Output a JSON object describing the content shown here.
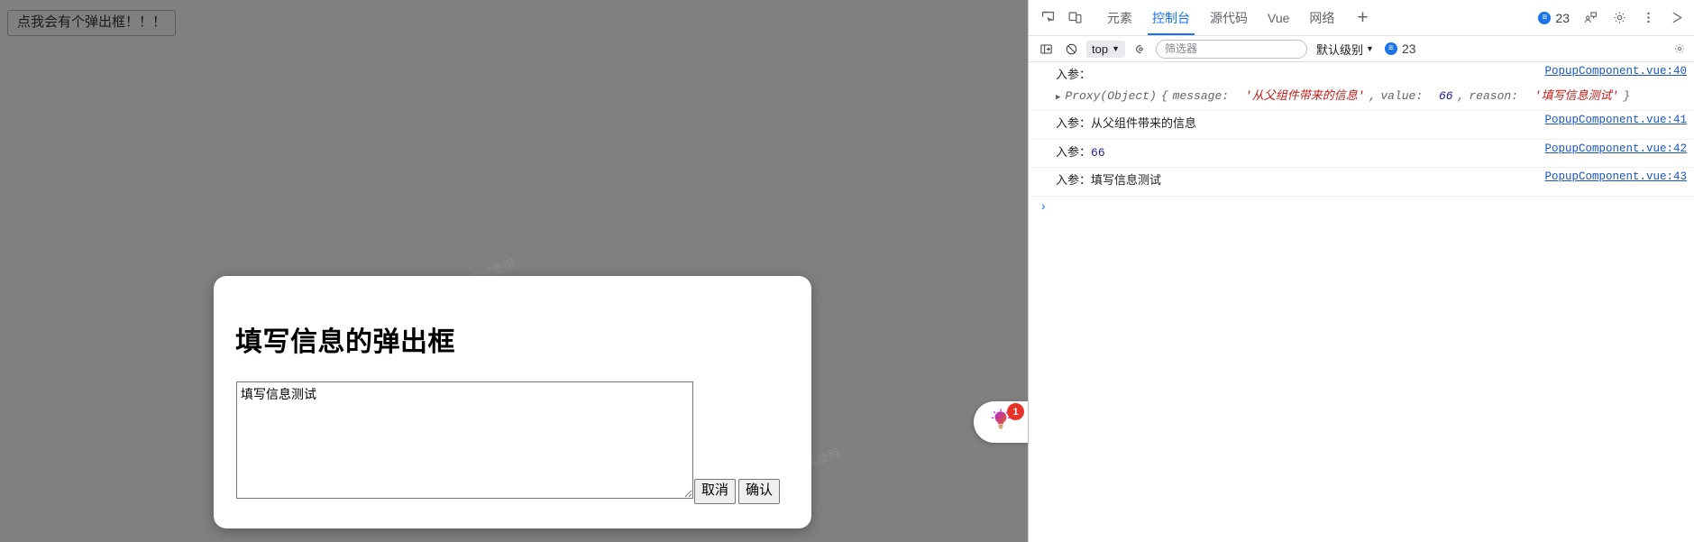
{
  "page": {
    "background_color": "#808080",
    "trigger_button_label": "点我会有个弹出框！！！",
    "watermark_text": "仅供学习测试使用"
  },
  "dialog": {
    "title": "填写信息的弹出框",
    "textarea_value": "填写信息测试",
    "textarea_placeholder": "",
    "cancel_label": "取消",
    "confirm_label": "确认"
  },
  "vue_extension": {
    "badge_count": "1",
    "icon": "lightbulb-icon"
  },
  "devtools": {
    "tabs": [
      {
        "label": "元素",
        "active": false
      },
      {
        "label": "控制台",
        "active": true
      },
      {
        "label": "源代码",
        "active": false
      },
      {
        "label": "Vue",
        "active": false
      },
      {
        "label": "网络",
        "active": false
      }
    ],
    "add_tab_label": "+",
    "icons": {
      "inspect": "inspect-element-icon",
      "device": "device-toolbar-icon",
      "feedback": "feedback-icon",
      "settings": "gear-icon",
      "more": "kebab-menu-icon",
      "close": "close-icon",
      "sidebar": "console-sidebar-icon",
      "clear": "clear-console-icon",
      "eye": "live-expression-icon",
      "toolbar_settings": "console-settings-icon"
    },
    "message_badge": {
      "count": "23",
      "glyph": "≡"
    },
    "toolbar": {
      "context": "top",
      "filter_placeholder": "筛选器",
      "filter_value": "",
      "level": "默认级别",
      "issues_count": "23"
    },
    "console": {
      "prompt": "›",
      "entries": [
        {
          "label": "入参：",
          "value": "",
          "value_type": "object",
          "object": {
            "disclosure": "▶",
            "type": "Proxy(Object)",
            "open_brace": "{",
            "close_brace": "}",
            "props": [
              {
                "key": "message:",
                "value": "'从父组件带来的信息'",
                "type": "string",
                "sep": ", "
              },
              {
                "key": "value:",
                "value": "66",
                "type": "number",
                "sep": ", "
              },
              {
                "key": "reason:",
                "value": "'填写信息测试'",
                "type": "string",
                "sep": ""
              }
            ]
          },
          "source": "PopupComponent.vue:40"
        },
        {
          "label": "入参：",
          "value": "从父组件带来的信息",
          "value_type": "string",
          "source": "PopupComponent.vue:41"
        },
        {
          "label": "入参：",
          "value": "66",
          "value_type": "number",
          "source": "PopupComponent.vue:42"
        },
        {
          "label": "入参：",
          "value": "填写信息测试",
          "value_type": "string",
          "source": "PopupComponent.vue:43"
        }
      ]
    }
  }
}
